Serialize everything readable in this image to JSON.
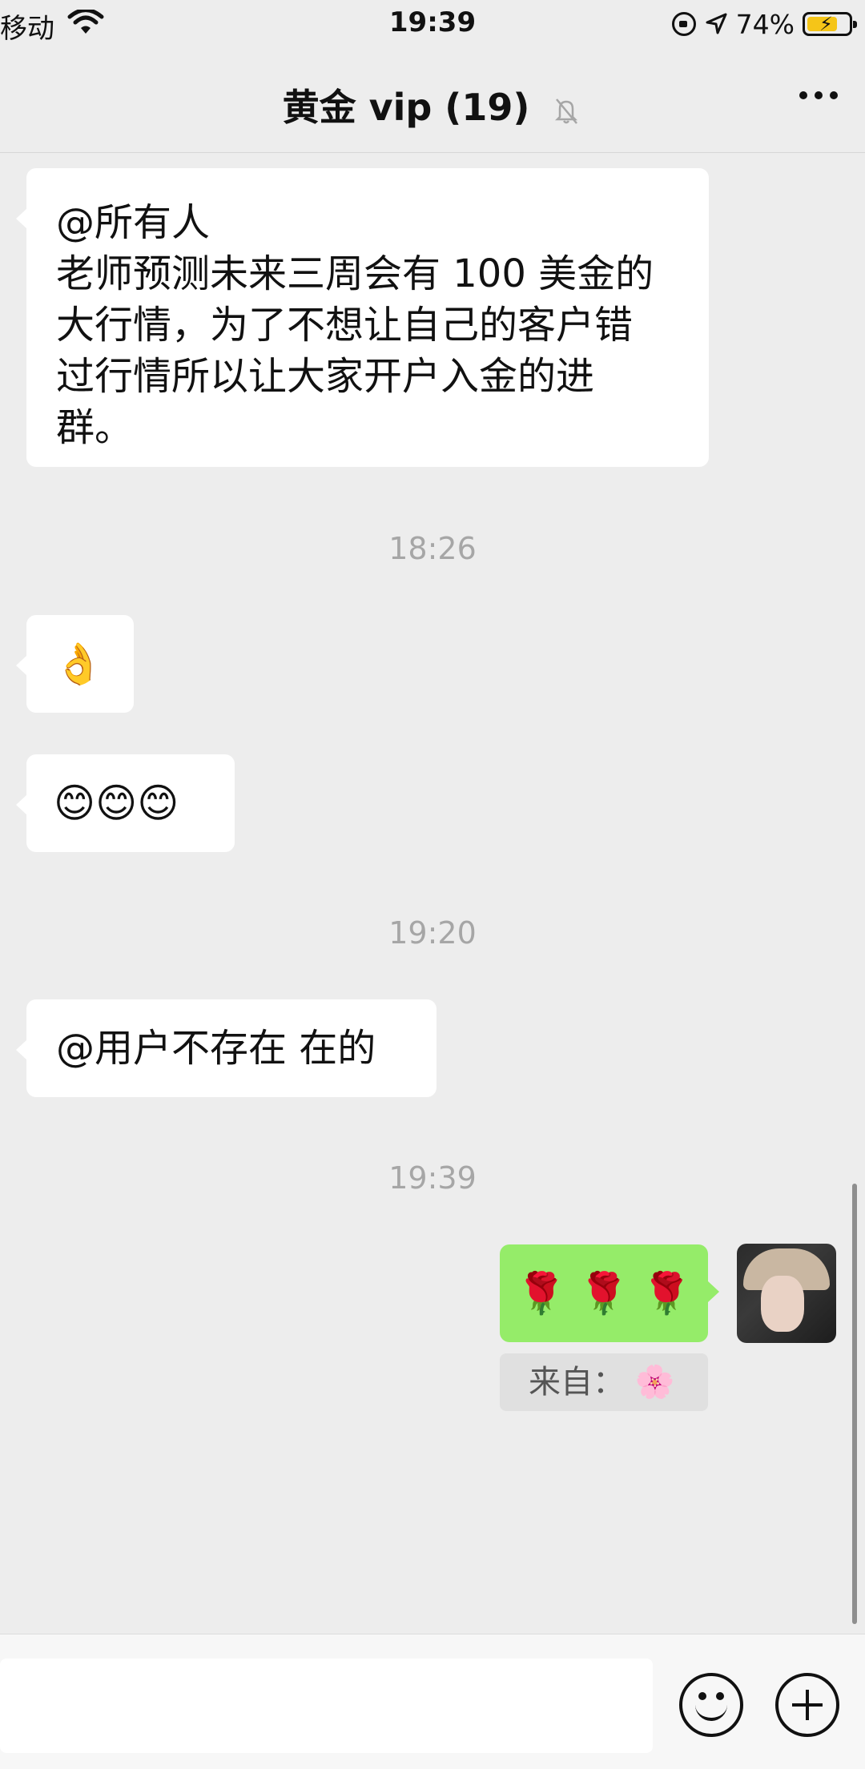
{
  "status_bar": {
    "carrier": "移动",
    "time": "19:39",
    "battery_percent": "74%",
    "battery_level": 0.74,
    "icons": [
      "wifi-icon",
      "rotation-lock-icon",
      "location-arrow-icon",
      "battery-charging-icon"
    ]
  },
  "header": {
    "title": "黄金 vip (19)",
    "icons": [
      "mute-bell-icon",
      "more-icon"
    ]
  },
  "messages": [
    {
      "side": "left",
      "text_lines": [
        "@所有人",
        "老师预测未来三周会有 100 美金的",
        "大行情，为了不想让自己的客户错",
        "过行情所以让大家开户入金的进",
        "群。"
      ]
    },
    {
      "timestamp": "18:26"
    },
    {
      "side": "left",
      "text": "👌"
    },
    {
      "side": "left",
      "text": "😊😊😊"
    },
    {
      "timestamp": "19:20"
    },
    {
      "side": "left",
      "text": "@用户不存在  在的"
    },
    {
      "timestamp": "19:39"
    },
    {
      "side": "right",
      "text": "🌹 🌹 🌹",
      "quote": "来自： 🌸"
    }
  ],
  "input_bar": {
    "icons": [
      "emoji-icon",
      "plus-icon"
    ]
  },
  "colors": {
    "background": "#ededed",
    "bubble_left": "#ffffff",
    "bubble_right": "#95ec69"
  }
}
